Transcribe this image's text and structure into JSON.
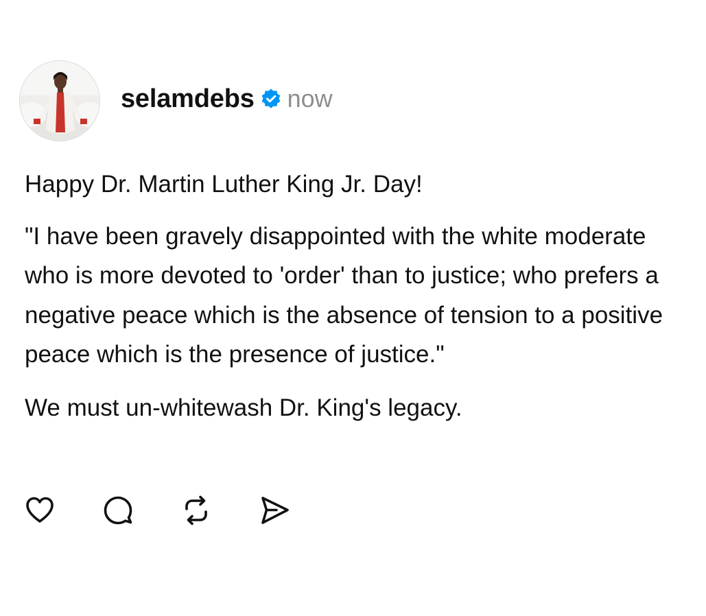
{
  "post": {
    "username": "selamdebs",
    "timestamp": "now",
    "avatar_icon": "profile-photo",
    "verified_icon": "verified-badge-icon",
    "verified_color": "#0095f6",
    "lines": {
      "greeting": "Happy Dr. Martin Luther King Jr. Day!",
      "quote": "\"I have been gravely disappointed with the white moderate who is more devoted to 'order' than to justice; who prefers a negative peace which is the absence of tension to a positive peace which is the presence of justice.\"",
      "closing": "We must un-whitewash Dr. King's legacy."
    },
    "actions": [
      {
        "icon": "heart-icon"
      },
      {
        "icon": "comment-icon"
      },
      {
        "icon": "repost-icon"
      },
      {
        "icon": "share-icon"
      }
    ]
  },
  "colors": {
    "text": "#111111",
    "muted": "#8e8e8e",
    "accent": "#0095f6"
  }
}
